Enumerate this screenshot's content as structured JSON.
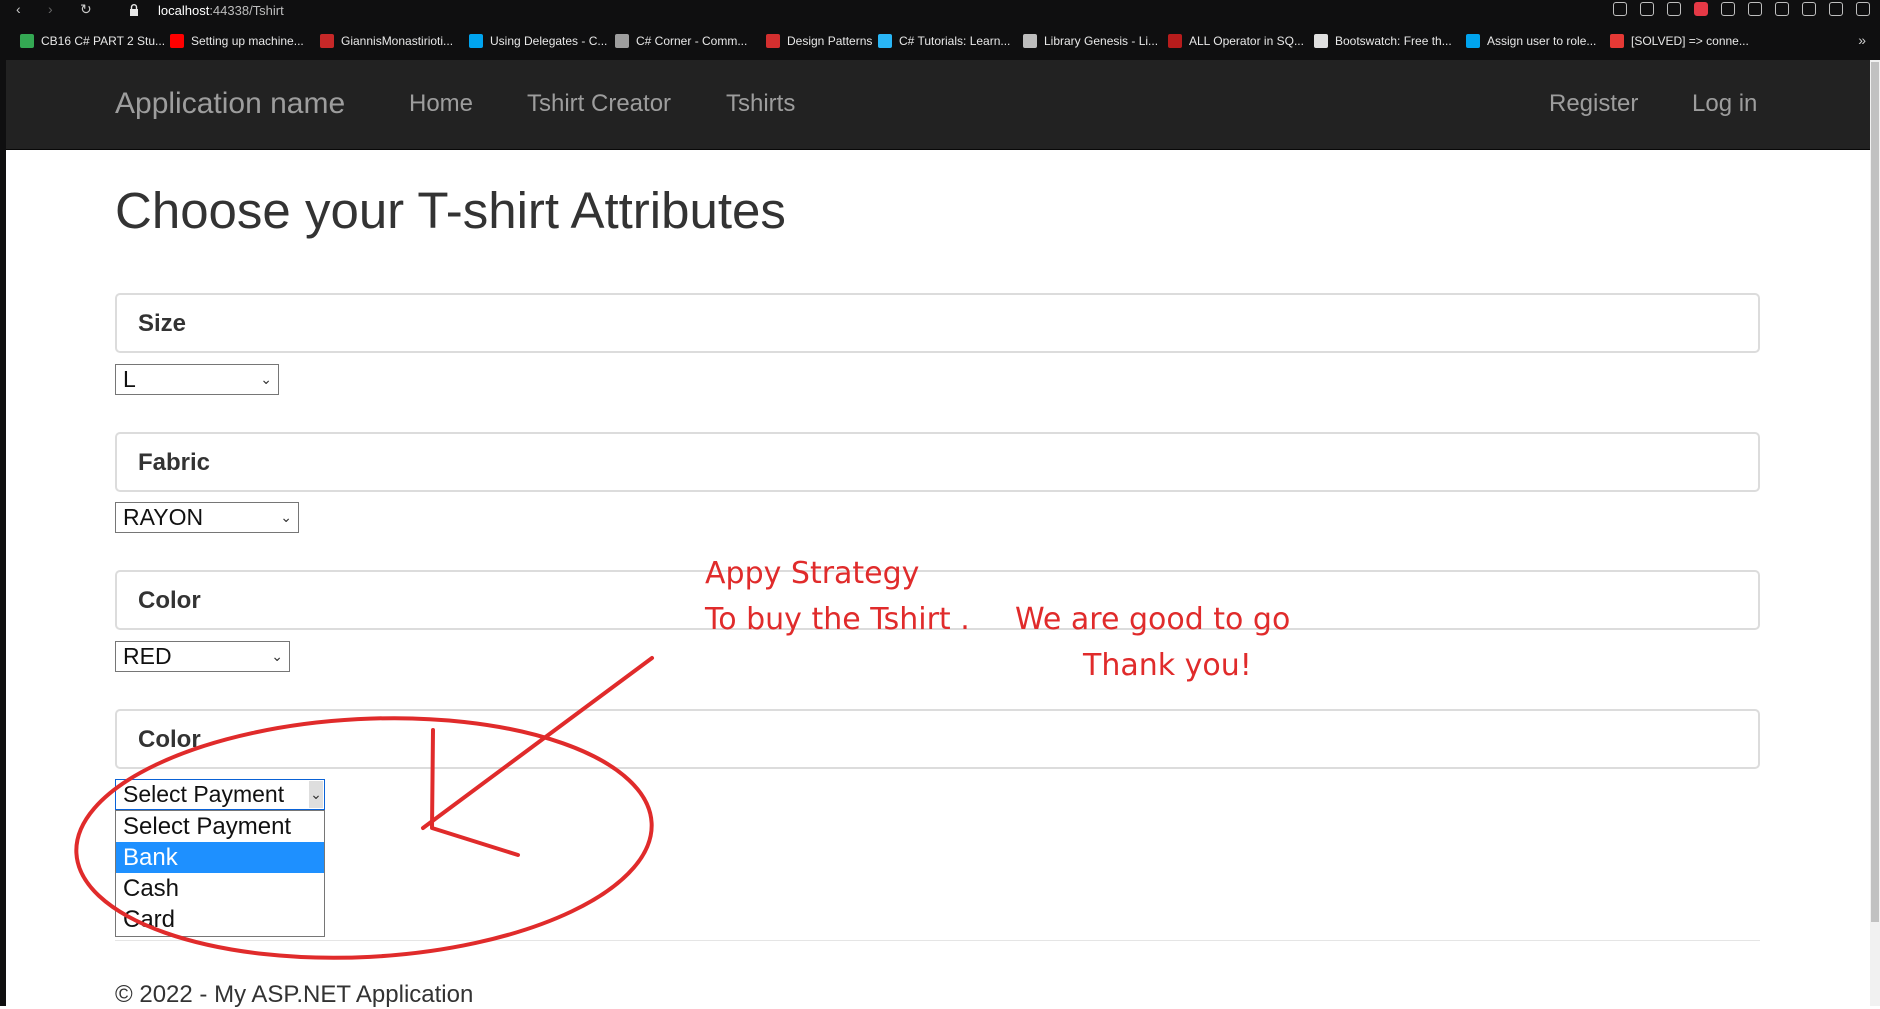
{
  "browser": {
    "url_host": "localhost",
    "url_rest": ":44338/Tshirt",
    "bookmarks": [
      {
        "label": "CB16 C# PART 2 Stu...",
        "color": "#34a853"
      },
      {
        "label": "Setting up machine...",
        "color": "#ff0000"
      },
      {
        "label": "GiannisMonastirioti...",
        "color": "#c62828"
      },
      {
        "label": "Using Delegates - C...",
        "color": "#00a4ef"
      },
      {
        "label": "C# Corner - Comm...",
        "color": "#9e9e9e"
      },
      {
        "label": "Design Patterns",
        "color": "#d32f2f"
      },
      {
        "label": "C# Tutorials: Learn...",
        "color": "#29b6f6"
      },
      {
        "label": "Library Genesis - Li...",
        "color": "#bdbdbd"
      },
      {
        "label": "ALL Operator in SQ...",
        "color": "#b71c1c"
      },
      {
        "label": "Bootswatch: Free th...",
        "color": "#e0e0e0"
      },
      {
        "label": "Assign user to role...",
        "color": "#00a4ef"
      },
      {
        "label": "[SOLVED] => conne...",
        "color": "#e53935"
      }
    ]
  },
  "navbar": {
    "brand": "Application name",
    "links": [
      "Home",
      "Tshirt Creator",
      "Tshirts"
    ],
    "right_links": [
      "Register",
      "Log in"
    ]
  },
  "main": {
    "title": "Choose your T-shirt Attributes",
    "sections": [
      {
        "heading": "Size",
        "value": "L"
      },
      {
        "heading": "Fabric",
        "value": "RAYON"
      },
      {
        "heading": "Color",
        "value": "RED"
      },
      {
        "heading": "Color",
        "value": "Select Payment"
      }
    ],
    "payment_options": [
      "Select Payment",
      "Bank",
      "Cash",
      "Card"
    ],
    "highlighted_option": "Bank"
  },
  "footer": {
    "text": "© 2022 - My ASP.NET Application"
  },
  "annotations": {
    "line1": "Appy Strategy",
    "line2": "To buy the Tshirt .",
    "line3": "We are good to go",
    "line4": "Thank you!",
    "color": "#e02b2b"
  }
}
